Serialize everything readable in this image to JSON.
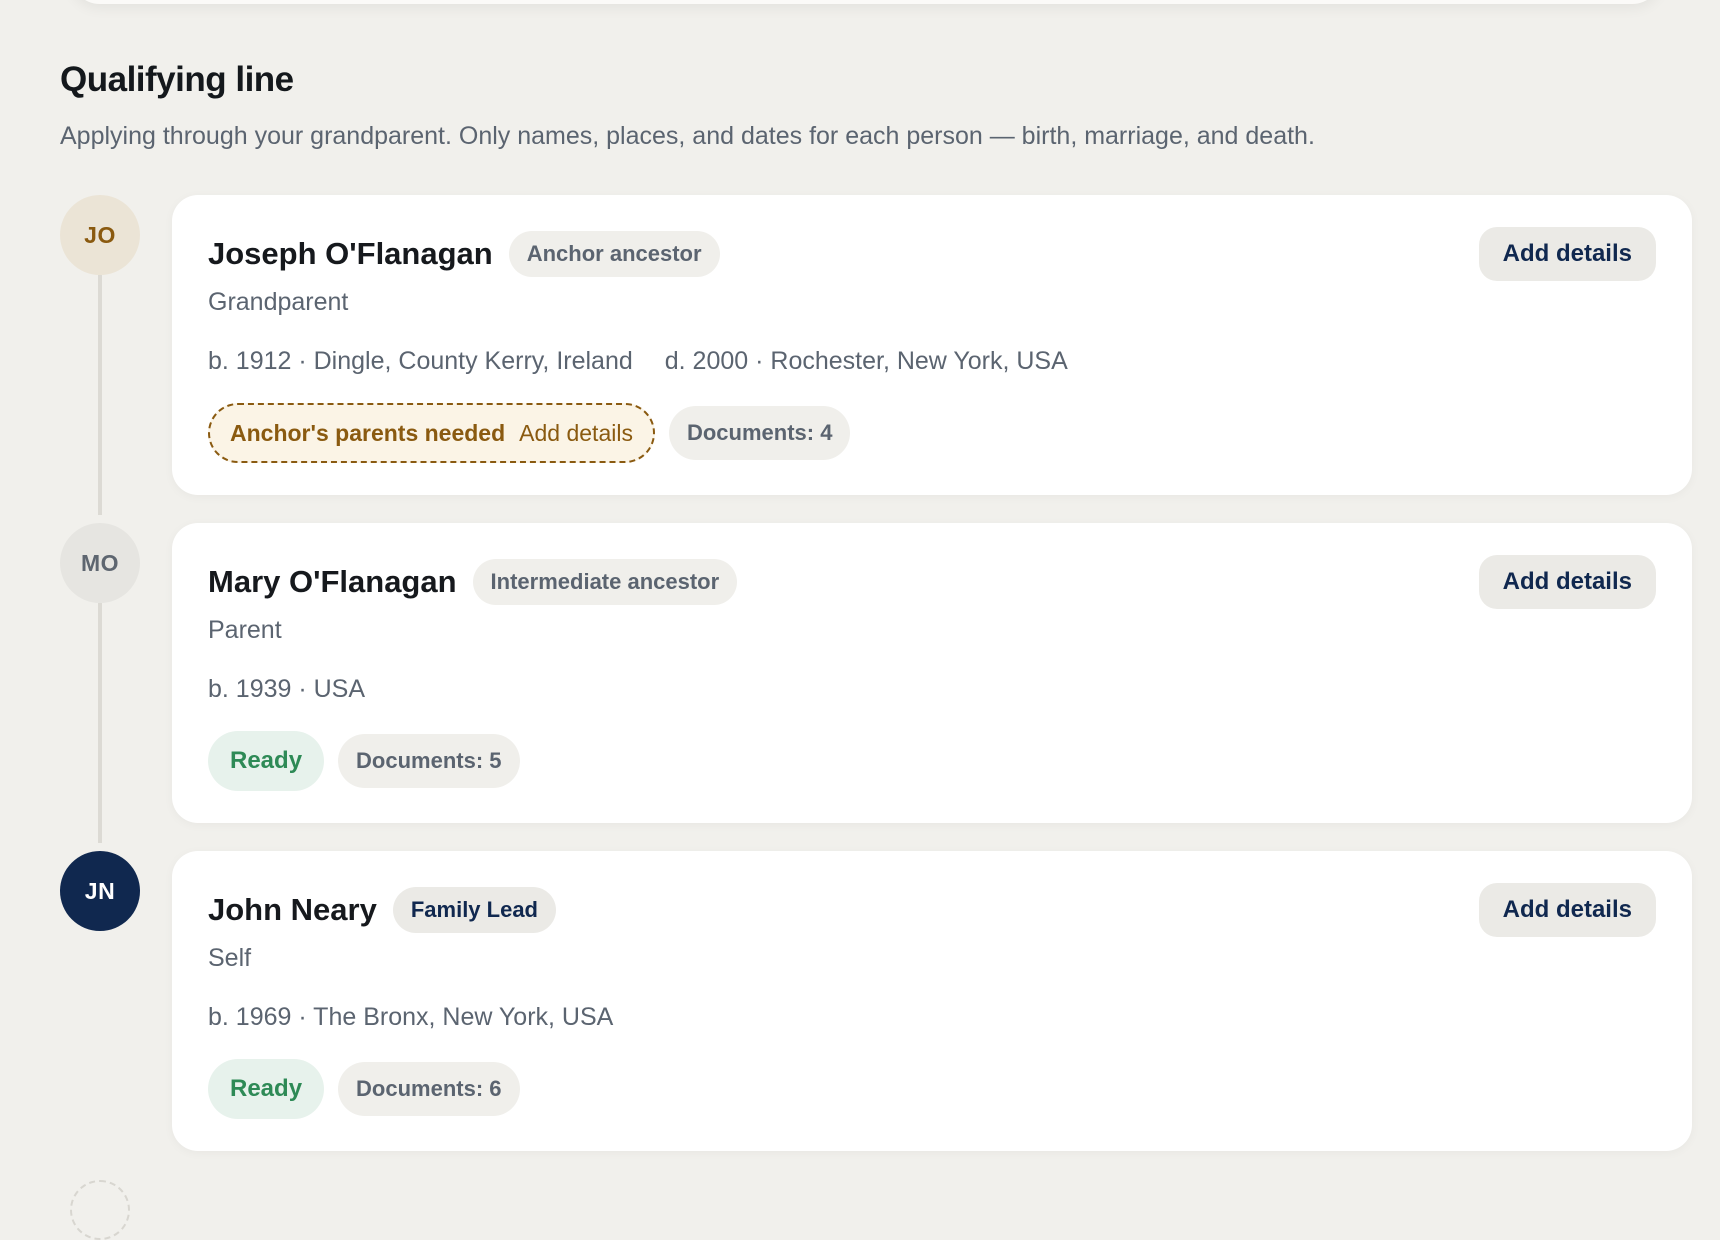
{
  "section": {
    "title": "Qualifying line",
    "subtitle": "Applying through your grandparent. Only names, places, and dates for each person — birth, marriage, and death."
  },
  "people": [
    {
      "initials": "JO",
      "name": "Joseph O'Flanagan",
      "role": "Anchor ancestor",
      "relation": "Grandparent",
      "birth": "b. 1912 · Dingle, County Kerry, Ireland",
      "death": "d. 2000 · Rochester, New York, USA",
      "status": "Anchor's parents needed",
      "status_action": "Add details",
      "documents": "Documents: 4",
      "button": "Add details"
    },
    {
      "initials": "MO",
      "name": "Mary O'Flanagan",
      "role": "Intermediate ancestor",
      "relation": "Parent",
      "birth": "b. 1939 · USA",
      "status": "Ready",
      "documents": "Documents: 5",
      "button": "Add details"
    },
    {
      "initials": "JN",
      "name": "John Neary",
      "role": "Family Lead",
      "relation": "Self",
      "birth": "b. 1969 · The Bronx, New York, USA",
      "status": "Ready",
      "documents": "Documents: 6",
      "button": "Add details"
    }
  ]
}
